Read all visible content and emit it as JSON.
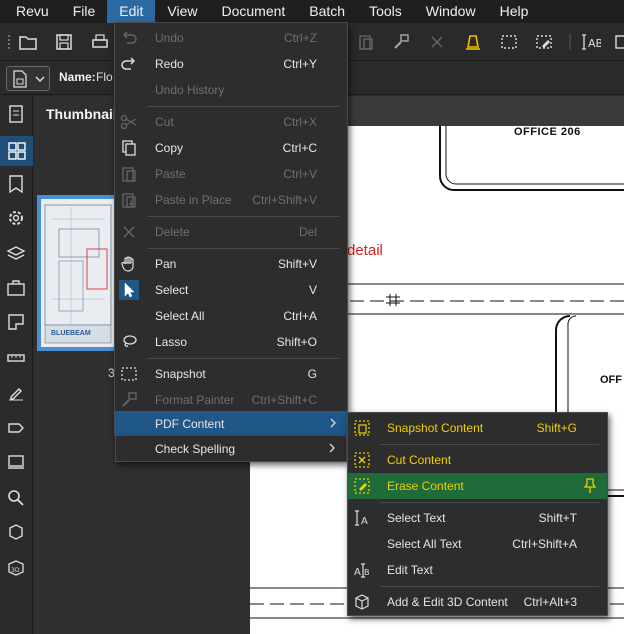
{
  "menubar": [
    "Revu",
    "File",
    "Edit",
    "View",
    "Document",
    "Batch",
    "Tools",
    "Window",
    "Help"
  ],
  "active_menu": "Edit",
  "file_bar": {
    "name_label": "Name:",
    "name_value": "Flo"
  },
  "thumbnails": {
    "title": "Thumbnail",
    "page_number": "3",
    "logo_text": "BLUEBEAM"
  },
  "drawing": {
    "room_label_1": "OFFICE  206",
    "room_label_2": "OFF",
    "detail_text": "detail",
    "detail_color": "#e02020"
  },
  "edit_menu": {
    "items": [
      {
        "label": "Undo",
        "shortcut": "Ctrl+Z",
        "icon": "undo-icon",
        "disabled": true
      },
      {
        "label": "Redo",
        "shortcut": "Ctrl+Y",
        "icon": "redo-icon",
        "disabled": false
      },
      {
        "label": "Undo History",
        "shortcut": "",
        "icon": "",
        "disabled": true
      },
      {
        "label": "Cut",
        "shortcut": "Ctrl+X",
        "icon": "scissors-icon",
        "disabled": true
      },
      {
        "label": "Copy",
        "shortcut": "Ctrl+C",
        "icon": "copy-icon",
        "disabled": false
      },
      {
        "label": "Paste",
        "shortcut": "Ctrl+V",
        "icon": "paste-icon",
        "disabled": true
      },
      {
        "label": "Paste in Place",
        "shortcut": "Ctrl+Shift+V",
        "icon": "paste-in-place-icon",
        "disabled": true
      },
      {
        "label": "Delete",
        "shortcut": "Del",
        "icon": "delete-x-icon",
        "disabled": true
      },
      {
        "label": "Pan",
        "shortcut": "Shift+V",
        "icon": "hand-icon",
        "disabled": false
      },
      {
        "label": "Select",
        "shortcut": "V",
        "icon": "cursor-arrow-icon",
        "disabled": false
      },
      {
        "label": "Select All",
        "shortcut": "Ctrl+A",
        "icon": "",
        "disabled": false
      },
      {
        "label": "Lasso",
        "shortcut": "Shift+O",
        "icon": "lasso-icon",
        "disabled": false
      },
      {
        "label": "Snapshot",
        "shortcut": "G",
        "icon": "snapshot-icon",
        "disabled": false
      },
      {
        "label": "Format Painter",
        "shortcut": "Ctrl+Shift+C",
        "icon": "paintbrush-icon",
        "disabled": true
      },
      {
        "label": "PDF Content",
        "shortcut": "",
        "icon": "",
        "disabled": false,
        "submenu": true
      },
      {
        "label": "Check Spelling",
        "shortcut": "",
        "icon": "",
        "disabled": false,
        "submenu": true
      }
    ]
  },
  "pdf_content_menu": {
    "items": [
      {
        "label": "Snapshot Content",
        "shortcut": "Shift+G",
        "icon": "snapshot-content-icon"
      },
      {
        "label": "Cut Content",
        "shortcut": "",
        "icon": "cut-content-icon"
      },
      {
        "label": "Erase Content",
        "shortcut": "",
        "icon": "erase-content-icon",
        "pinned": true
      },
      {
        "label": "Select Text",
        "shortcut": "Shift+T",
        "icon": "select-text-icon"
      },
      {
        "label": "Select All Text",
        "shortcut": "Ctrl+Shift+A",
        "icon": ""
      },
      {
        "label": "Edit Text",
        "shortcut": "",
        "icon": "edit-text-icon"
      },
      {
        "label": "Add & Edit 3D Content",
        "shortcut": "Ctrl+Alt+3",
        "icon": "cube-icon"
      }
    ],
    "label_color": "#f0d000"
  },
  "colors": {
    "accent": "#2c6aa3",
    "highlight": "#1f5788",
    "green_highlight": "#1f6b3a",
    "tool_yellow": "#f0c000"
  }
}
